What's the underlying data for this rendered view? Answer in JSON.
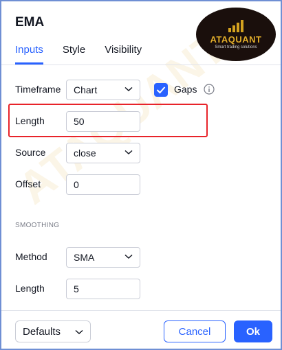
{
  "dialog": {
    "title": "EMA",
    "logo": {
      "name": "ATAQUANT",
      "tagline": "Smart trading solutions"
    },
    "watermark": "ATAQUANT"
  },
  "tabs": [
    {
      "label": "Inputs",
      "active": true
    },
    {
      "label": "Style",
      "active": false
    },
    {
      "label": "Visibility",
      "active": false
    }
  ],
  "inputs": {
    "timeframe": {
      "label": "Timeframe",
      "value": "Chart"
    },
    "gaps": {
      "label": "Gaps",
      "checked": true
    },
    "length": {
      "label": "Length",
      "value": "50"
    },
    "source": {
      "label": "Source",
      "value": "close"
    },
    "offset": {
      "label": "Offset",
      "value": "0"
    }
  },
  "smoothing": {
    "header": "SMOOTHING",
    "method": {
      "label": "Method",
      "value": "SMA"
    },
    "length": {
      "label": "Length",
      "value": "5"
    }
  },
  "footer": {
    "defaults_label": "Defaults",
    "cancel_label": "Cancel",
    "ok_label": "Ok"
  },
  "colors": {
    "accent": "#2962ff",
    "highlight": "#e8232a",
    "logo_gold": "#e0ac2a"
  }
}
